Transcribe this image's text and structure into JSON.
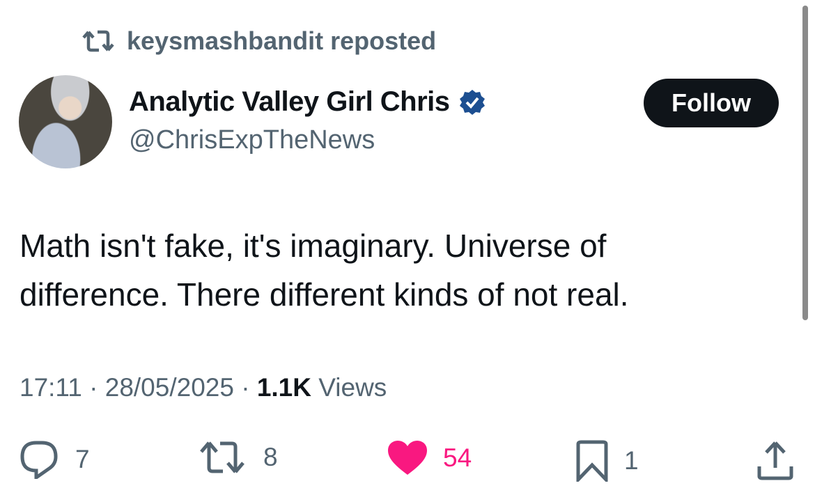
{
  "repost": {
    "icon": "repost-icon",
    "text": "keysmashbandit reposted"
  },
  "author": {
    "name": "Analytic Valley Girl Chris",
    "handle": "@ChrisExpTheNews",
    "verified": true,
    "badge_color": "#1d4f91"
  },
  "follow_label": "Follow",
  "tweet": {
    "line1": "Math isn't fake, it's imaginary. Universe of",
    "line2": "difference. There different kinds of not real."
  },
  "meta": {
    "time": "17:11",
    "sep1": " · ",
    "date": "28/05/2025",
    "sep2": " · ",
    "views": "1.1K",
    "views_label": " Views"
  },
  "actions": {
    "replies": "7",
    "reposts": "8",
    "likes": "54",
    "bookmarks": "1",
    "like_color": "#f91880",
    "liked": true
  }
}
